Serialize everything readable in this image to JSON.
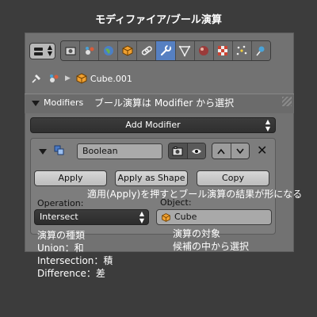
{
  "caption": "モディファイア/ブール演算",
  "context": {
    "object_name": "Cube.001"
  },
  "modifiers_panel": {
    "title": "Modifiers",
    "annotation": "ブール演算は Modifier から選択",
    "add_modifier_label": "Add Modifier"
  },
  "modifier": {
    "name": "Boolean",
    "apply_label": "Apply",
    "apply_as_shape_label": "Apply as Shape",
    "copy_label": "Copy",
    "apply_annotation": "適用(Apply)を押すとブール演算の結果が形になる",
    "operation_label": "Operation:",
    "operation_value": "Intersect",
    "object_label": "Object:",
    "object_value": "Cube"
  },
  "annotations": {
    "types_title": "演算の種類",
    "types": [
      "Union：和",
      "Intersection：積",
      "Difference：差"
    ],
    "target_line1": "演算の対象",
    "target_line2": "候補の中から選択"
  },
  "icons": {
    "tabs": [
      "render-icon",
      "scene-icon",
      "world-icon",
      "object-icon",
      "constraints-icon",
      "modifiers-icon",
      "data-icon",
      "material-icon",
      "texture-icon",
      "particles-icon",
      "physics-icon"
    ],
    "active_tab": "modifiers-icon"
  },
  "colors": {
    "background": "#3c3c3c",
    "panel": "#727272",
    "active_tab": "#5680c2"
  }
}
